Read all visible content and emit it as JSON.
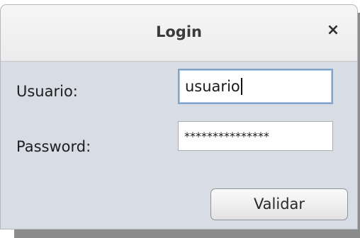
{
  "window": {
    "title": "Login",
    "close_symbol": "×"
  },
  "form": {
    "usuario_label": "Usuario:",
    "usuario_value": "usuario",
    "password_label": "Password:",
    "password_value": "***************"
  },
  "actions": {
    "validar_label": "Validar"
  },
  "icons": {
    "close": "close-icon"
  }
}
